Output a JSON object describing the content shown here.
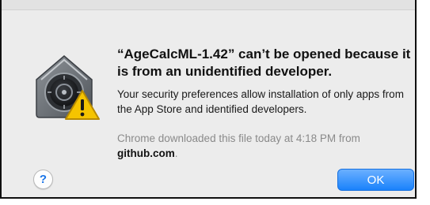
{
  "dialog": {
    "headline": "“AgeCalcML-1.42” can’t be opened because it is from an unidentified developer.",
    "message": "Your security preferences allow installation of only apps from the App Store and identified developers.",
    "source_prefix": "Chrome downloaded this file today at 4:18 PM from",
    "source_host": "github.com",
    "source_suffix": ".",
    "help_label": "?",
    "ok_label": "OK"
  },
  "icons": {
    "app_icon": "gatekeeper-lock-icon",
    "warning_badge": "warning-triangle-icon"
  },
  "colors": {
    "accent": "#1a82fb",
    "warning": "#f5c400",
    "help": "#1a74e8"
  }
}
